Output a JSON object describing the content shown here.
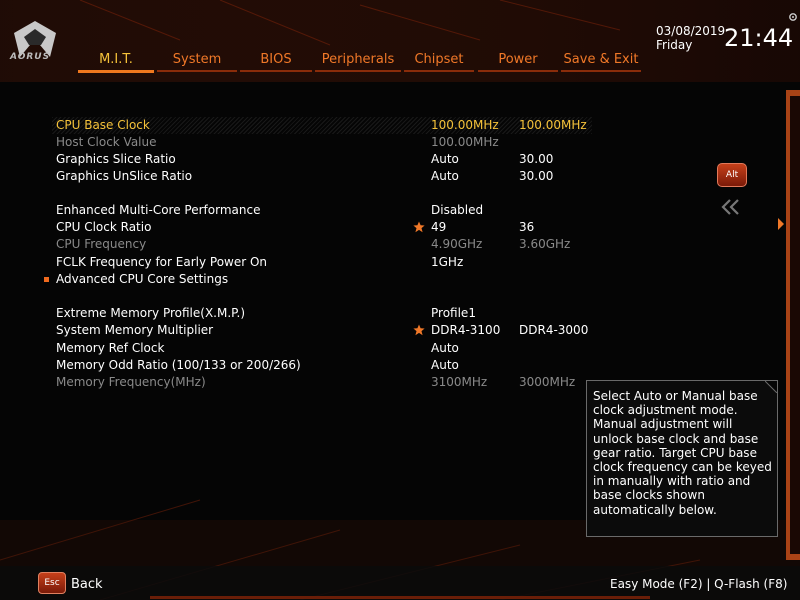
{
  "brand": {
    "logo_text": "AORUS"
  },
  "header": {
    "tabs": [
      {
        "label": "M.I.T.",
        "active": true
      },
      {
        "label": "System",
        "active": false
      },
      {
        "label": "BIOS",
        "active": false
      },
      {
        "label": "Peripherals",
        "active": false
      },
      {
        "label": "Chipset",
        "active": false
      },
      {
        "label": "Power",
        "active": false
      },
      {
        "label": "Save & Exit",
        "active": false
      }
    ],
    "date": "03/08/2019",
    "day": "Friday",
    "time": "21:44"
  },
  "settings": [
    {
      "label": "CPU Base Clock",
      "value": "100.00MHz",
      "current": "100.00MHz",
      "selected": true
    },
    {
      "label": "Host Clock Value",
      "value": "100.00MHz",
      "current": "",
      "dim": true
    },
    {
      "label": "Graphics Slice Ratio",
      "value": "Auto",
      "current": "30.00"
    },
    {
      "label": "Graphics UnSlice Ratio",
      "value": "Auto",
      "current": "30.00"
    },
    {
      "label": "Enhanced Multi-Core Performance",
      "value": "Disabled",
      "current": ""
    },
    {
      "label": "CPU Clock Ratio",
      "value": "49",
      "current": "36",
      "starred": true
    },
    {
      "label": "CPU Frequency",
      "value": "4.90GHz",
      "current": "3.60GHz",
      "dim": true
    },
    {
      "label": "FCLK Frequency for Early Power On",
      "value": "1GHz",
      "current": ""
    },
    {
      "label": "Advanced CPU Core Settings",
      "value": "",
      "current": "",
      "submenu": true
    },
    {
      "label": "Extreme Memory Profile(X.M.P.)",
      "value": "Profile1",
      "current": ""
    },
    {
      "label": "System Memory Multiplier",
      "value": "DDR4-3100",
      "current": "DDR4-3000",
      "starred": true
    },
    {
      "label": "Memory Ref Clock",
      "value": "Auto",
      "current": ""
    },
    {
      "label": "Memory Odd Ratio (100/133 or 200/266)",
      "value": "Auto",
      "current": ""
    },
    {
      "label": "Memory Frequency(MHz)",
      "value": "3100MHz",
      "current": "3000MHz",
      "dim": true
    }
  ],
  "side": {
    "alt_label": "Alt",
    "collapse_icon": "double-chevron-left-icon"
  },
  "help": {
    "text": "Select Auto or Manual base clock adjustment mode. Manual adjustment will unlock base clock and base gear ratio. Target CPU base clock frequency can be keyed in manually with ratio and base clocks shown automatically below."
  },
  "footer": {
    "esc_label": "Esc",
    "back_label": "Back",
    "right_text": "Easy Mode (F2)  |  Q-Flash (F8)"
  },
  "colors": {
    "accent": "#f07828",
    "selected_text": "#f5c23a",
    "dim_text": "#8a8a8a"
  }
}
